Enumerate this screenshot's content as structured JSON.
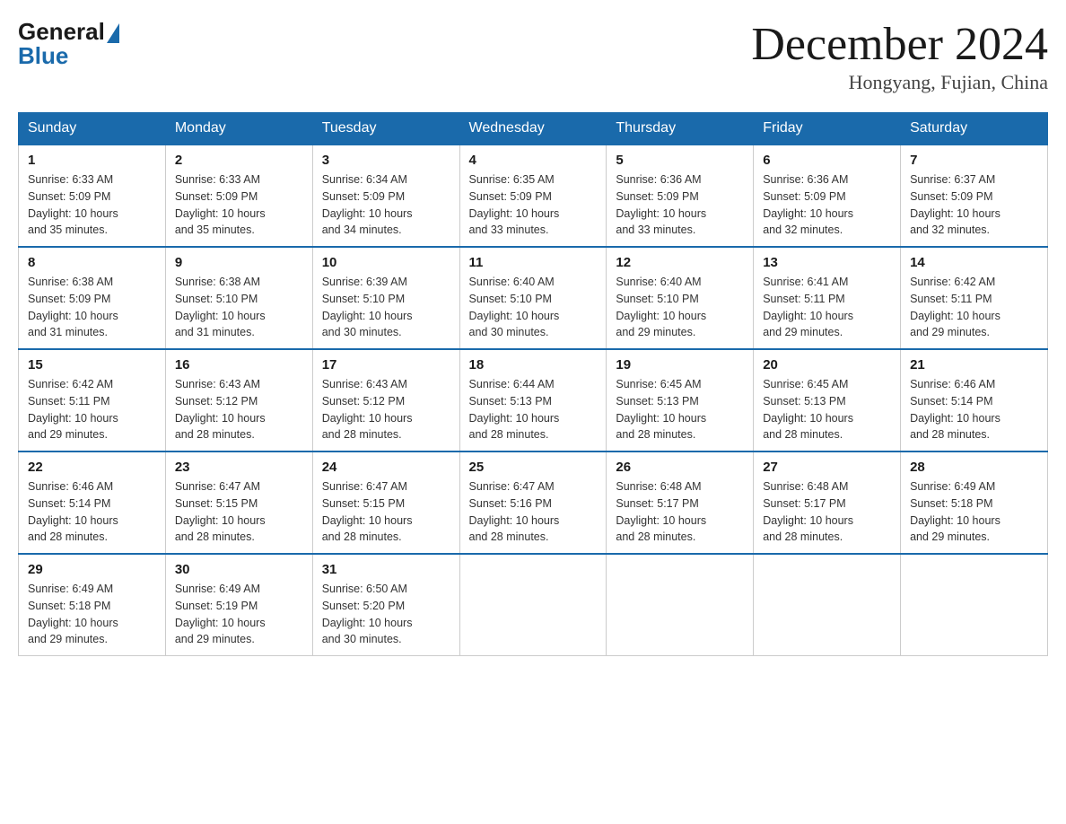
{
  "header": {
    "logo": {
      "general": "General",
      "blue": "Blue"
    },
    "title": "December 2024",
    "location": "Hongyang, Fujian, China"
  },
  "days_of_week": [
    "Sunday",
    "Monday",
    "Tuesday",
    "Wednesday",
    "Thursday",
    "Friday",
    "Saturday"
  ],
  "weeks": [
    [
      {
        "day": "1",
        "sunrise": "6:33 AM",
        "sunset": "5:09 PM",
        "daylight": "10 hours and 35 minutes."
      },
      {
        "day": "2",
        "sunrise": "6:33 AM",
        "sunset": "5:09 PM",
        "daylight": "10 hours and 35 minutes."
      },
      {
        "day": "3",
        "sunrise": "6:34 AM",
        "sunset": "5:09 PM",
        "daylight": "10 hours and 34 minutes."
      },
      {
        "day": "4",
        "sunrise": "6:35 AM",
        "sunset": "5:09 PM",
        "daylight": "10 hours and 33 minutes."
      },
      {
        "day": "5",
        "sunrise": "6:36 AM",
        "sunset": "5:09 PM",
        "daylight": "10 hours and 33 minutes."
      },
      {
        "day": "6",
        "sunrise": "6:36 AM",
        "sunset": "5:09 PM",
        "daylight": "10 hours and 32 minutes."
      },
      {
        "day": "7",
        "sunrise": "6:37 AM",
        "sunset": "5:09 PM",
        "daylight": "10 hours and 32 minutes."
      }
    ],
    [
      {
        "day": "8",
        "sunrise": "6:38 AM",
        "sunset": "5:09 PM",
        "daylight": "10 hours and 31 minutes."
      },
      {
        "day": "9",
        "sunrise": "6:38 AM",
        "sunset": "5:10 PM",
        "daylight": "10 hours and 31 minutes."
      },
      {
        "day": "10",
        "sunrise": "6:39 AM",
        "sunset": "5:10 PM",
        "daylight": "10 hours and 30 minutes."
      },
      {
        "day": "11",
        "sunrise": "6:40 AM",
        "sunset": "5:10 PM",
        "daylight": "10 hours and 30 minutes."
      },
      {
        "day": "12",
        "sunrise": "6:40 AM",
        "sunset": "5:10 PM",
        "daylight": "10 hours and 29 minutes."
      },
      {
        "day": "13",
        "sunrise": "6:41 AM",
        "sunset": "5:11 PM",
        "daylight": "10 hours and 29 minutes."
      },
      {
        "day": "14",
        "sunrise": "6:42 AM",
        "sunset": "5:11 PM",
        "daylight": "10 hours and 29 minutes."
      }
    ],
    [
      {
        "day": "15",
        "sunrise": "6:42 AM",
        "sunset": "5:11 PM",
        "daylight": "10 hours and 29 minutes."
      },
      {
        "day": "16",
        "sunrise": "6:43 AM",
        "sunset": "5:12 PM",
        "daylight": "10 hours and 28 minutes."
      },
      {
        "day": "17",
        "sunrise": "6:43 AM",
        "sunset": "5:12 PM",
        "daylight": "10 hours and 28 minutes."
      },
      {
        "day": "18",
        "sunrise": "6:44 AM",
        "sunset": "5:13 PM",
        "daylight": "10 hours and 28 minutes."
      },
      {
        "day": "19",
        "sunrise": "6:45 AM",
        "sunset": "5:13 PM",
        "daylight": "10 hours and 28 minutes."
      },
      {
        "day": "20",
        "sunrise": "6:45 AM",
        "sunset": "5:13 PM",
        "daylight": "10 hours and 28 minutes."
      },
      {
        "day": "21",
        "sunrise": "6:46 AM",
        "sunset": "5:14 PM",
        "daylight": "10 hours and 28 minutes."
      }
    ],
    [
      {
        "day": "22",
        "sunrise": "6:46 AM",
        "sunset": "5:14 PM",
        "daylight": "10 hours and 28 minutes."
      },
      {
        "day": "23",
        "sunrise": "6:47 AM",
        "sunset": "5:15 PM",
        "daylight": "10 hours and 28 minutes."
      },
      {
        "day": "24",
        "sunrise": "6:47 AM",
        "sunset": "5:15 PM",
        "daylight": "10 hours and 28 minutes."
      },
      {
        "day": "25",
        "sunrise": "6:47 AM",
        "sunset": "5:16 PM",
        "daylight": "10 hours and 28 minutes."
      },
      {
        "day": "26",
        "sunrise": "6:48 AM",
        "sunset": "5:17 PM",
        "daylight": "10 hours and 28 minutes."
      },
      {
        "day": "27",
        "sunrise": "6:48 AM",
        "sunset": "5:17 PM",
        "daylight": "10 hours and 28 minutes."
      },
      {
        "day": "28",
        "sunrise": "6:49 AM",
        "sunset": "5:18 PM",
        "daylight": "10 hours and 29 minutes."
      }
    ],
    [
      {
        "day": "29",
        "sunrise": "6:49 AM",
        "sunset": "5:18 PM",
        "daylight": "10 hours and 29 minutes."
      },
      {
        "day": "30",
        "sunrise": "6:49 AM",
        "sunset": "5:19 PM",
        "daylight": "10 hours and 29 minutes."
      },
      {
        "day": "31",
        "sunrise": "6:50 AM",
        "sunset": "5:20 PM",
        "daylight": "10 hours and 30 minutes."
      },
      null,
      null,
      null,
      null
    ]
  ],
  "labels": {
    "sunrise": "Sunrise:",
    "sunset": "Sunset:",
    "daylight": "Daylight:"
  }
}
